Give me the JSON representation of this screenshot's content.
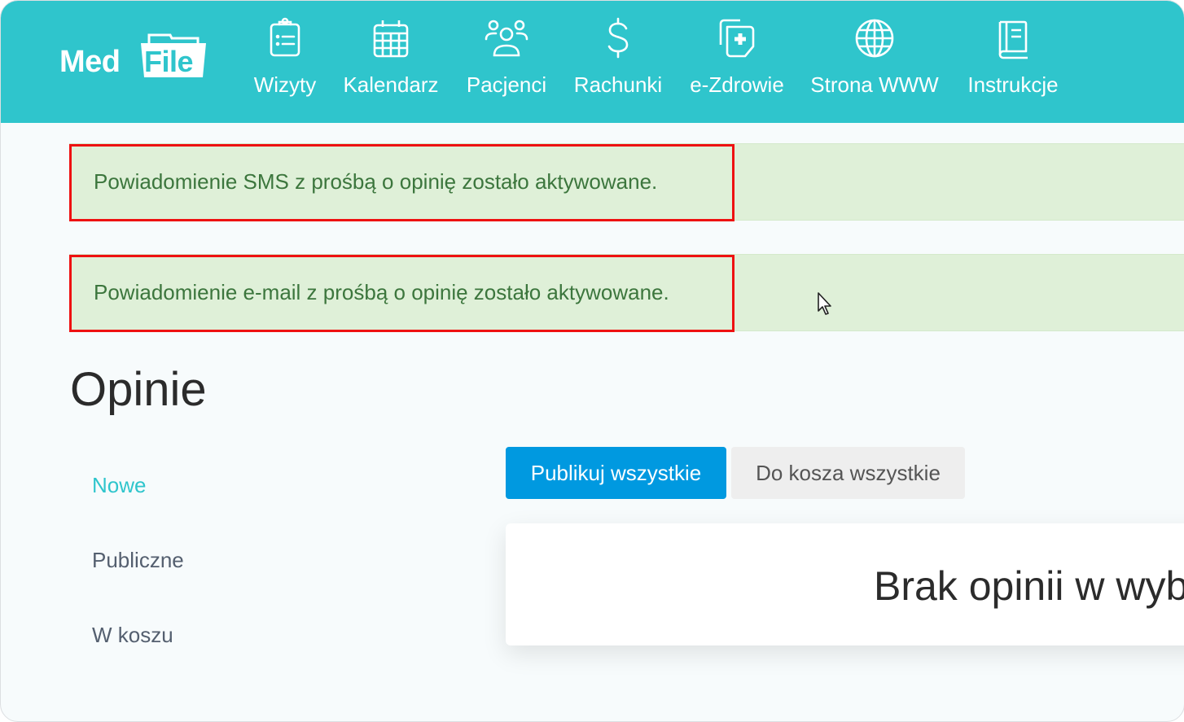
{
  "app": {
    "logo_text_1": "Med",
    "logo_text_2": "File",
    "brand_color": "#2fc5cc"
  },
  "nav": {
    "items": [
      {
        "label": "Wizyty",
        "icon": "clipboard-list-icon"
      },
      {
        "label": "Kalendarz",
        "icon": "calendar-icon"
      },
      {
        "label": "Pacjenci",
        "icon": "users-icon"
      },
      {
        "label": "Rachunki",
        "icon": "dollar-icon"
      },
      {
        "label": "e-Zdrowie",
        "icon": "medical-documents-icon"
      },
      {
        "label": "Strona WWW",
        "icon": "globe-icon"
      },
      {
        "label": "Instrukcje",
        "icon": "book-icon"
      }
    ]
  },
  "alerts": [
    {
      "text": "Powiadomienie SMS z prośbą o opinię zostało aktywowane.",
      "type": "success"
    },
    {
      "text": "Powiadomienie e-mail z prośbą o opinię zostało aktywowane.",
      "type": "success"
    }
  ],
  "page": {
    "title": "Opinie"
  },
  "sidebar": {
    "items": [
      {
        "label": "Nowe",
        "active": true
      },
      {
        "label": "Publiczne",
        "active": false
      },
      {
        "label": "W koszu",
        "active": false
      }
    ]
  },
  "toolbar": {
    "publish_all_label": "Publikuj wszystkie",
    "trash_all_label": "Do kosza wszystkie"
  },
  "content": {
    "empty_message": "Brak opinii w wyb"
  }
}
